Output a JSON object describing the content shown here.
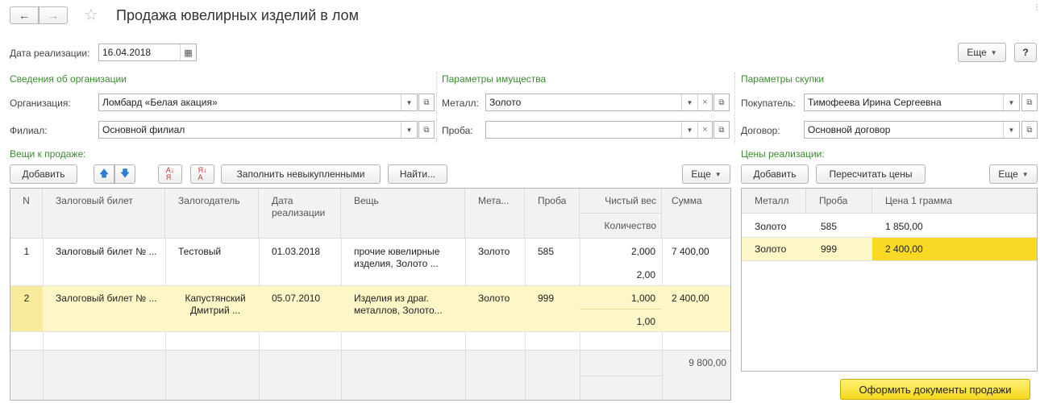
{
  "window": {
    "title": "Продажа ювелирных изделий в лом",
    "back_icon": "arrow-left-icon",
    "forward_icon": "arrow-right-icon",
    "favorite_icon": "star-icon"
  },
  "header": {
    "date_label": "Дата реализации:",
    "date_value": "16.04.2018",
    "more_label": "Еще",
    "help_label": "?"
  },
  "org": {
    "section_title": "Сведения об организации",
    "org_label": "Организация:",
    "org_value": "Ломбард «Белая акация»",
    "branch_label": "Филиал:",
    "branch_value": "Основной филиал"
  },
  "property": {
    "section_title": "Параметры имущества",
    "metal_label": "Металл:",
    "metal_value": "Золото",
    "assay_label": "Проба:",
    "assay_value": ""
  },
  "purchase": {
    "section_title": "Параметры скупки",
    "buyer_label": "Покупатель:",
    "buyer_value": "Тимофеева Ирина Сергеевна",
    "contract_label": "Договор:",
    "contract_value": "Основной договор"
  },
  "items": {
    "section_title": "Вещи к продаже:",
    "toolbar": {
      "add": "Добавить",
      "fill": "Заполнить невыкупленными",
      "find": "Найти...",
      "more": "Еще"
    },
    "columns": {
      "n": "N",
      "ticket": "Залоговый билет",
      "pledger": "Залогодатель",
      "date": "Дата реализации",
      "item": "Вещь",
      "metal": "Мета...",
      "assay": "Проба",
      "weight": "Чистый вес",
      "qty": "Количество",
      "sum": "Сумма"
    },
    "rows": [
      {
        "n": "1",
        "ticket": "Залоговый билет № ...",
        "pledger": "Тестовый",
        "date": "01.03.2018",
        "item": "прочие ювелирные изделия, Золото ...",
        "metal": "Золото",
        "assay": "585",
        "weight": "2,000",
        "qty": "2,00",
        "sum": "7 400,00"
      },
      {
        "n": "2",
        "ticket": "Залоговый билет № ...",
        "pledger": "Капустянский Дмитрий ...",
        "date": "05.07.2010",
        "item": "Изделия из драг. металлов, Золото...",
        "metal": "Золото",
        "assay": "999",
        "weight": "1,000",
        "qty": "1,00",
        "sum": "2 400,00"
      }
    ],
    "total_sum": "9 800,00"
  },
  "prices": {
    "section_title": "Цены реализации:",
    "toolbar": {
      "add": "Добавить",
      "recalc": "Пересчитать цены",
      "more": "Еще"
    },
    "columns": {
      "metal": "Металл",
      "assay": "Проба",
      "price": "Цена 1 грамма"
    },
    "rows": [
      {
        "metal": "Золото",
        "assay": "585",
        "price": "1 850,00"
      },
      {
        "metal": "Золото",
        "assay": "999",
        "price": "2 400,00"
      }
    ]
  },
  "footer": {
    "submit_label": "Оформить документы продажи"
  },
  "colors": {
    "accent_green": "#3a8c2f",
    "selected_row": "#fdf7c8",
    "selected_cell": "#f9d923",
    "primary_button": "#f4d91a"
  }
}
